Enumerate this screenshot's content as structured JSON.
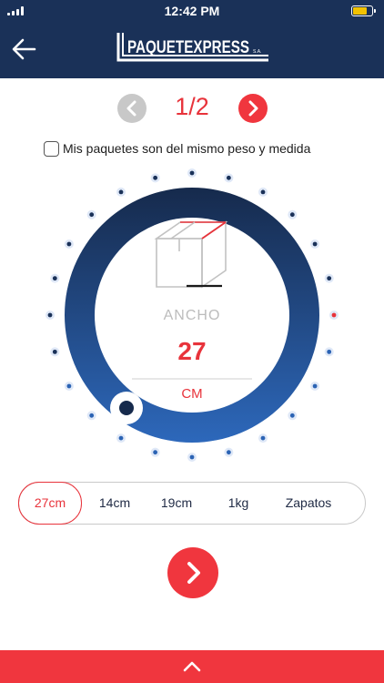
{
  "status_bar": {
    "time": "12:42 PM"
  },
  "header": {
    "logo_text": "PAQUETEXPRESS",
    "logo_suffix": "S.A."
  },
  "pager": {
    "text": "1/2"
  },
  "same_package": {
    "label": "Mis paquetes son del mismo peso y medida",
    "checked": false
  },
  "dial": {
    "label": "ANCHO",
    "value": "27",
    "unit": "CM"
  },
  "chips": [
    {
      "label": "27cm",
      "active": true
    },
    {
      "label": "14cm",
      "active": false
    },
    {
      "label": "19cm",
      "active": false
    },
    {
      "label": "1kg",
      "active": false
    },
    {
      "label": "Zapatos",
      "active": false
    }
  ],
  "colors": {
    "navy": "#1a3158",
    "red": "#f0363e",
    "blue": "#2b63b4"
  },
  "icons": {
    "back": "arrow-left-icon",
    "prev": "chevron-left-icon",
    "next": "chevron-right-icon",
    "box": "package-box-icon",
    "expand": "chevron-up-icon"
  }
}
